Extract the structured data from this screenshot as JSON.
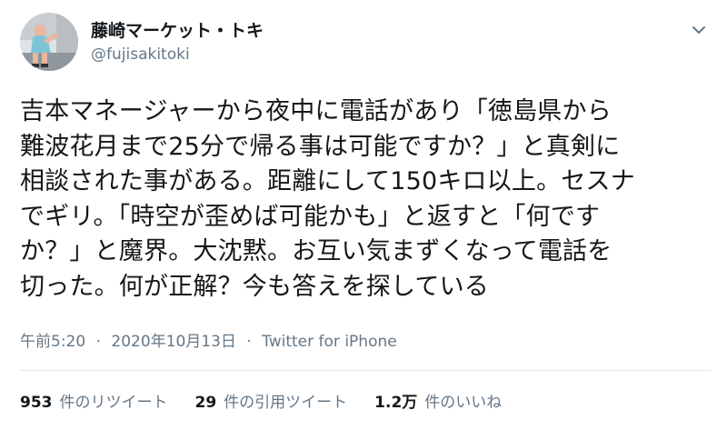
{
  "author": {
    "display_name": "藤崎マーケット・トキ",
    "handle": "@fujisakitoki"
  },
  "tweet": {
    "lines": [
      "吉本マネージャーから夜中に電話があり「徳島県から",
      "難波花月まで25分で帰る事は可能ですか？」と真剣に",
      "相談された事がある。距離にして150キロ以上。セスナ",
      "でギリ。「時空が歪めば可能かも」と返すと「何です",
      "か？」と魔界。大沈黙。お互い気まずくなって電話を",
      "切った。何が正解？今も答えを探している"
    ]
  },
  "meta": {
    "time": "午前5:20",
    "separator": "·",
    "date": "2020年10月13日",
    "source": "Twitter for iPhone"
  },
  "stats": {
    "retweets_count": "953",
    "retweets_label": "件のリツイート",
    "quotes_count": "29",
    "quotes_label": "件の引用ツイート",
    "likes_count": "1.2万",
    "likes_label": "件のいいね"
  },
  "icons": {
    "caret": "chevron-down-icon",
    "avatar": "avatar"
  },
  "colors": {
    "text_primary": "#14171a",
    "text_secondary": "#657786",
    "divider": "#e1e8ed"
  }
}
